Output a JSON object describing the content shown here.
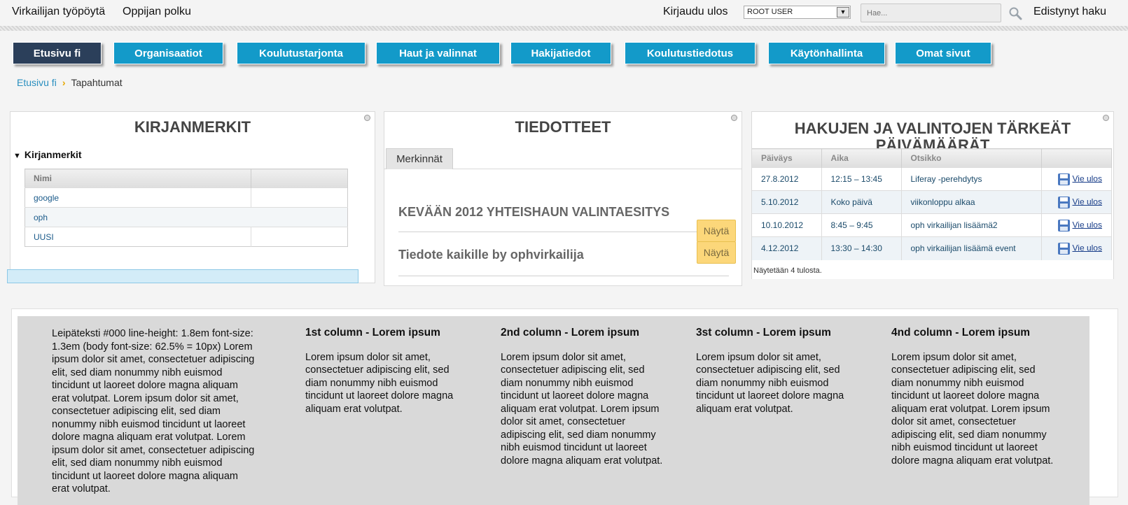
{
  "topbar": {
    "link_desktop": "Virkailijan työpöytä",
    "link_path": "Oppijan polku",
    "logout": "Kirjaudu ulos",
    "user_select": "ROOT USER",
    "search_placeholder": "Hae...",
    "advanced_search": "Edistynyt haku"
  },
  "nav": {
    "items": [
      {
        "label": "Etusivu fi"
      },
      {
        "label": "Organisaatiot"
      },
      {
        "label": "Koulutustarjonta"
      },
      {
        "label": "Haut ja valinnat"
      },
      {
        "label": "Hakijatiedot"
      },
      {
        "label": "Koulutustiedotus"
      },
      {
        "label": "Käytönhallinta"
      },
      {
        "label": "Omat sivut"
      }
    ],
    "active_color": "#2b3f5a",
    "color": "#139ac9"
  },
  "breadcrumb": {
    "home": "Etusivu fi",
    "separator": "›",
    "current": "Tapahtumat"
  },
  "bookmarks": {
    "title": "KIRJANMERKIT",
    "toggle_label": "Kirjanmerkit",
    "col_name": "Nimi",
    "rows": [
      {
        "name": "google"
      },
      {
        "name": "oph"
      },
      {
        "name": "UUSI"
      }
    ]
  },
  "news": {
    "title": "TIEDOTTEET",
    "tab_label": "Merkinnät",
    "items": [
      {
        "title": "KEVÄÄN 2012 YHTEISHAUN VALINTAESITYS",
        "button": "Näytä"
      },
      {
        "title": "Tiedote kaikille by ophvirkailija",
        "button": "Näytä"
      }
    ]
  },
  "dates": {
    "title": "HAKUJEN JA VALINTOJEN TÄRKEÄT PÄIVÄMÄÄRÄT",
    "columns": [
      "Päiväys",
      "Aika",
      "Otsikko",
      ""
    ],
    "rows": [
      {
        "date": "27.8.2012",
        "time": "12:15 – 13:45",
        "subject": "Liferay -perehdytys",
        "export": "Vie ulos"
      },
      {
        "date": "5.10.2012",
        "time": "Koko päivä",
        "subject": "viikonloppu alkaa",
        "export": "Vie ulos"
      },
      {
        "date": "10.10.2012",
        "time": "8:45 – 9:45",
        "subject": "oph virkailijan lisäämä2",
        "export": "Vie ulos"
      },
      {
        "date": "4.12.2012",
        "time": "13:30 – 14:30",
        "subject": "oph virkailijan lisäämä event",
        "export": "Vie ulos"
      }
    ],
    "footer": "Näytetään 4 tulosta."
  },
  "content": {
    "intro": "Leipäteksti #000 line-height: 1.8em font-size: 1.3em (body font-size: 62.5% = 10px) Lorem ipsum dolor sit amet, consectetuer adipiscing elit, sed diam nonummy nibh euismod tincidunt ut laoreet dolore magna aliquam erat volutpat. Lorem ipsum dolor sit amet, consectetuer adipiscing elit, sed diam nonummy nibh euismod tincidunt ut laoreet dolore magna aliquam erat volutpat. Lorem ipsum dolor sit amet, consectetuer adipiscing elit, sed diam nonummy nibh euismod tincidunt ut laoreet dolore magna aliquam erat volutpat.",
    "columns": [
      {
        "heading": "1st column - Lorem ipsum",
        "text": "Lorem ipsum dolor sit amet, consectetuer adipiscing elit, sed diam nonummy nibh euismod tincidunt ut laoreet dolore magna aliquam erat volutpat."
      },
      {
        "heading": "2nd column - Lorem ipsum",
        "text": "Lorem ipsum dolor sit amet, consectetuer adipiscing elit, sed diam nonummy nibh euismod tincidunt ut laoreet dolore magna aliquam erat volutpat. Lorem ipsum dolor sit amet, consectetuer adipiscing elit, sed diam nonummy nibh euismod tincidunt ut laoreet dolore magna aliquam erat volutpat."
      },
      {
        "heading": "3st column - Lorem ipsum",
        "text": "Lorem ipsum dolor sit amet, consectetuer adipiscing elit, sed diam nonummy nibh euismod tincidunt ut laoreet dolore magna aliquam erat volutpat."
      },
      {
        "heading": "4nd column - Lorem ipsum",
        "text": "Lorem ipsum dolor sit amet, consectetuer adipiscing elit, sed diam nonummy nibh euismod tincidunt ut laoreet dolore magna aliquam erat volutpat. Lorem ipsum dolor sit amet, consectetuer adipiscing elit, sed diam nonummy nibh euismod tincidunt ut laoreet dolore magna aliquam erat volutpat."
      }
    ]
  }
}
